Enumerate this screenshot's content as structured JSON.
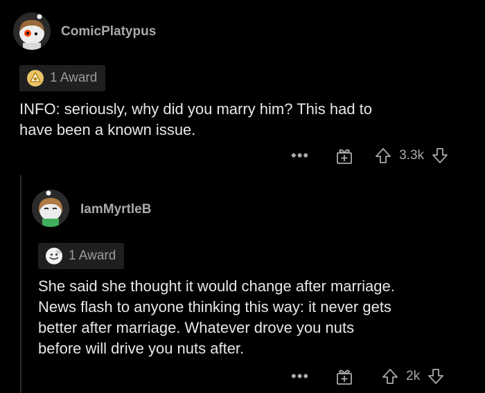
{
  "comments": [
    {
      "username": "ComicPlatypus",
      "award_text": "1 Award",
      "body": [
        "INFO: seriously, why did you marry him? This had to",
        "have been a known issue."
      ],
      "score": "3.3k",
      "more_label": "•••"
    },
    {
      "username": "IamMyrtleB",
      "award_text": "1 Award",
      "body": [
        "She said she thought it would change after marriage.",
        "News flash to anyone thinking this way: it never gets",
        "better after marriage. Whatever drove you nuts",
        "before will drive you nuts after."
      ],
      "score": "2k",
      "more_label": "•••"
    }
  ],
  "icons": {
    "avatar_1": "snoo-avatar-icon",
    "avatar_2": "snoo-avatar-icon",
    "award_1": "gold-award-icon",
    "award_2": "wholesome-award-icon",
    "gift": "gift-icon",
    "upvote": "upvote-arrow-icon",
    "downvote": "downvote-arrow-icon"
  },
  "colors": {
    "background": "#000000",
    "text": "#e6e8e9",
    "muted": "#a8aaab",
    "award_bg": "#1f1f1f",
    "thread_line": "#2b2b2b"
  }
}
